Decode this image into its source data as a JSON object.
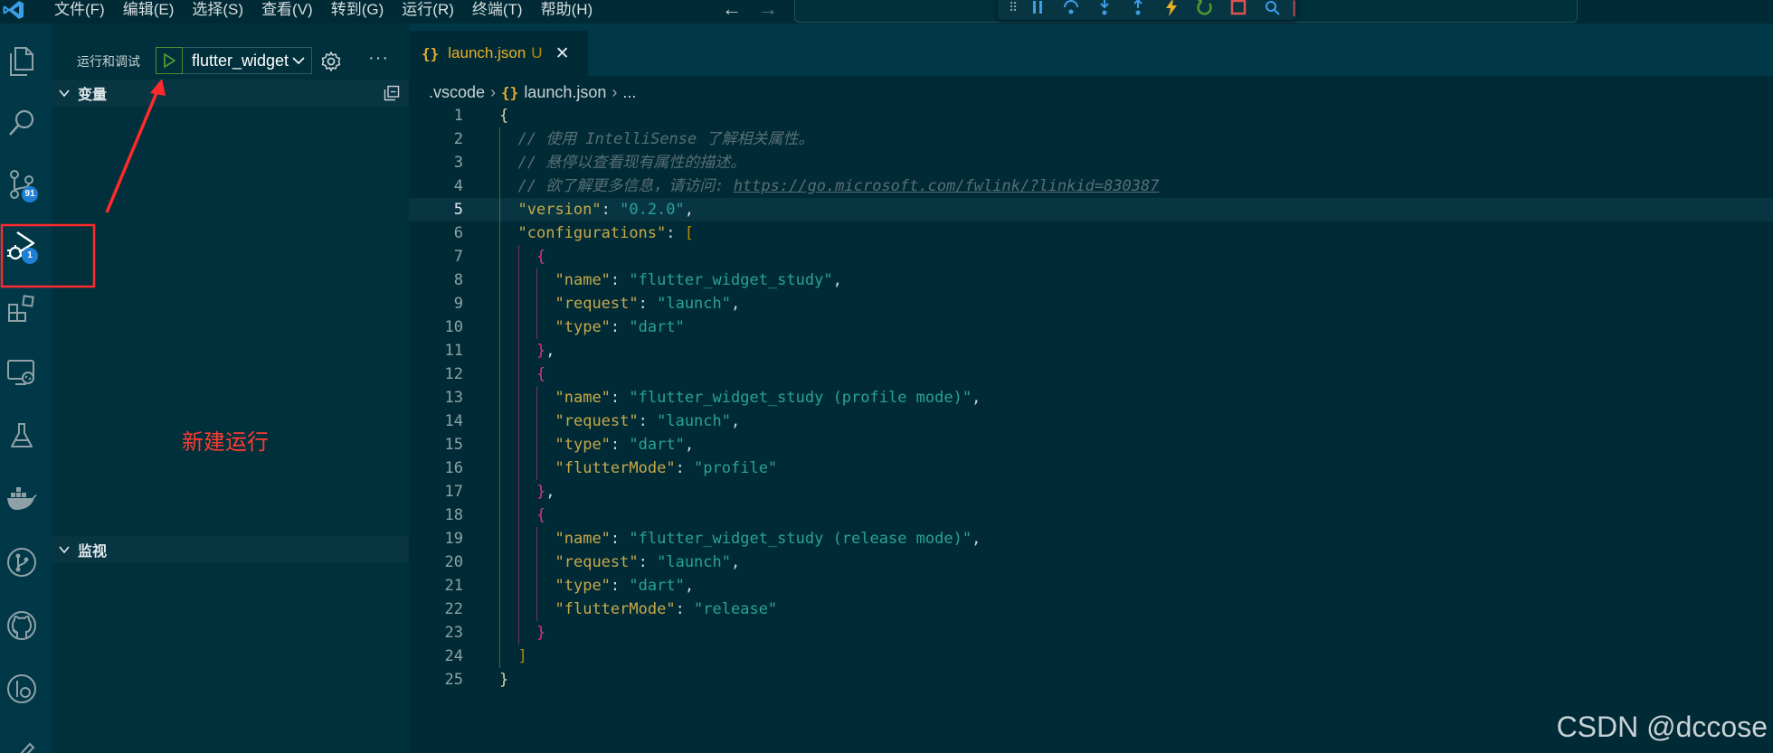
{
  "menu": [
    "文件(F)",
    "编辑(E)",
    "选择(S)",
    "查看(V)",
    "转到(G)",
    "运行(R)",
    "终端(T)",
    "帮助(H)"
  ],
  "nav": {
    "back": "←",
    "forward": "→"
  },
  "activity_badges": {
    "source_control": "91",
    "run_debug": "1"
  },
  "sidebar": {
    "title": "运行和调试",
    "config_selected": "flutter_widget",
    "more": "···",
    "sections": {
      "variables": "变量",
      "watch": "监视"
    },
    "annotation": "新建运行"
  },
  "editor": {
    "tab": {
      "name": "launch.json",
      "status": "U",
      "close": "✕"
    },
    "breadcrumb": {
      "folder": ".vscode",
      "file": "launch.json",
      "ellipsis": "..."
    },
    "lines": [
      {
        "n": "1",
        "t": [
          [
            "{",
            "t-brace"
          ]
        ]
      },
      {
        "n": "2",
        "t": [
          [
            "// 使用 IntelliSense 了解相关属性。",
            "t-cmt"
          ]
        ]
      },
      {
        "n": "3",
        "t": [
          [
            "// 悬停以查看现有属性的描述。",
            "t-cmt"
          ]
        ]
      },
      {
        "n": "4",
        "t": [
          [
            "// 欲了解更多信息，请访问: ",
            "t-cmt"
          ],
          [
            "https://go.microsoft.com/fwlink/?linkid=830387",
            "t-link"
          ]
        ]
      },
      {
        "n": "5",
        "t": [
          [
            "\"version\"",
            "t-key"
          ],
          [
            ": ",
            "t-punc"
          ],
          [
            "\"0.2.0\"",
            "t-num"
          ],
          [
            ",",
            "t-punc"
          ]
        ]
      },
      {
        "n": "6",
        "t": [
          [
            "\"configurations\"",
            "t-key"
          ],
          [
            ": ",
            "t-punc"
          ],
          [
            "[",
            "t-brack"
          ]
        ]
      },
      {
        "n": "7",
        "t": [
          [
            "{",
            "t-brace2"
          ]
        ]
      },
      {
        "n": "8",
        "t": [
          [
            "\"name\"",
            "t-key"
          ],
          [
            ": ",
            "t-punc"
          ],
          [
            "\"flutter_widget_study\"",
            "t-str"
          ],
          [
            ",",
            "t-punc"
          ]
        ]
      },
      {
        "n": "9",
        "t": [
          [
            "\"request\"",
            "t-key"
          ],
          [
            ": ",
            "t-punc"
          ],
          [
            "\"launch\"",
            "t-str"
          ],
          [
            ",",
            "t-punc"
          ]
        ]
      },
      {
        "n": "10",
        "t": [
          [
            "\"type\"",
            "t-key"
          ],
          [
            ": ",
            "t-punc"
          ],
          [
            "\"dart\"",
            "t-str"
          ]
        ]
      },
      {
        "n": "11",
        "t": [
          [
            "}",
            "t-brace2"
          ],
          [
            ",",
            "t-punc"
          ]
        ]
      },
      {
        "n": "12",
        "t": [
          [
            "{",
            "t-brace2"
          ]
        ]
      },
      {
        "n": "13",
        "t": [
          [
            "\"name\"",
            "t-key"
          ],
          [
            ": ",
            "t-punc"
          ],
          [
            "\"flutter_widget_study (profile mode)\"",
            "t-str"
          ],
          [
            ",",
            "t-punc"
          ]
        ]
      },
      {
        "n": "14",
        "t": [
          [
            "\"request\"",
            "t-key"
          ],
          [
            ": ",
            "t-punc"
          ],
          [
            "\"launch\"",
            "t-str"
          ],
          [
            ",",
            "t-punc"
          ]
        ]
      },
      {
        "n": "15",
        "t": [
          [
            "\"type\"",
            "t-key"
          ],
          [
            ": ",
            "t-punc"
          ],
          [
            "\"dart\"",
            "t-str"
          ],
          [
            ",",
            "t-punc"
          ]
        ]
      },
      {
        "n": "16",
        "t": [
          [
            "\"flutterMode\"",
            "t-key"
          ],
          [
            ": ",
            "t-punc"
          ],
          [
            "\"profile\"",
            "t-str"
          ]
        ]
      },
      {
        "n": "17",
        "t": [
          [
            "}",
            "t-brace2"
          ],
          [
            ",",
            "t-punc"
          ]
        ]
      },
      {
        "n": "18",
        "t": [
          [
            "{",
            "t-brace2"
          ]
        ]
      },
      {
        "n": "19",
        "t": [
          [
            "\"name\"",
            "t-key"
          ],
          [
            ": ",
            "t-punc"
          ],
          [
            "\"flutter_widget_study (release mode)\"",
            "t-str"
          ],
          [
            ",",
            "t-punc"
          ]
        ]
      },
      {
        "n": "20",
        "t": [
          [
            "\"request\"",
            "t-key"
          ],
          [
            ": ",
            "t-punc"
          ],
          [
            "\"launch\"",
            "t-str"
          ],
          [
            ",",
            "t-punc"
          ]
        ]
      },
      {
        "n": "21",
        "t": [
          [
            "\"type\"",
            "t-key"
          ],
          [
            ": ",
            "t-punc"
          ],
          [
            "\"dart\"",
            "t-str"
          ],
          [
            ",",
            "t-punc"
          ]
        ]
      },
      {
        "n": "22",
        "t": [
          [
            "\"flutterMode\"",
            "t-key"
          ],
          [
            ": ",
            "t-punc"
          ],
          [
            "\"release\"",
            "t-str"
          ]
        ]
      },
      {
        "n": "23",
        "t": [
          [
            "}",
            "t-brace2"
          ]
        ]
      },
      {
        "n": "24",
        "t": [
          [
            "]",
            "t-brack"
          ]
        ]
      },
      {
        "n": "25",
        "t": [
          [
            "}",
            "t-brace"
          ]
        ]
      }
    ],
    "active_line": "5"
  },
  "watermark": "CSDN @dccose",
  "colors": {
    "accent_blue": "#1f7fd4",
    "annotation_red": "#ff2a2a",
    "run_green": "#4e9a2e"
  }
}
